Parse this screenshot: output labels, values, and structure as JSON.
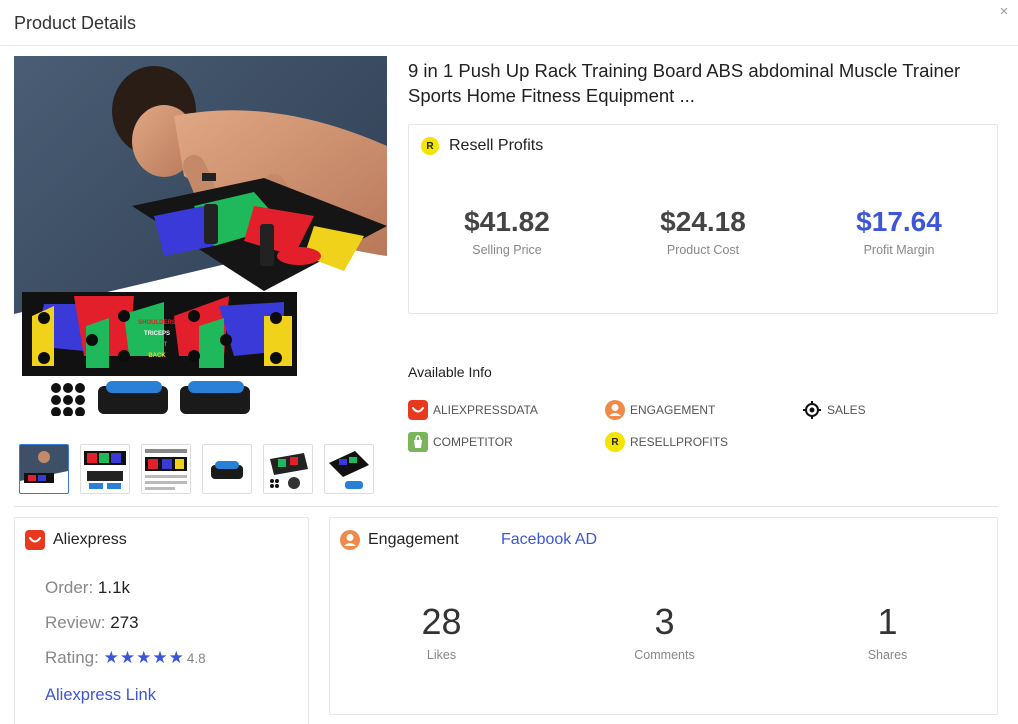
{
  "header": {
    "title": "Product Details",
    "close_symbol": "×"
  },
  "product": {
    "title": "9 in 1 Push Up Rack Training Board ABS abdominal Muscle Trainer Sports Home Fitness Equipment ...",
    "board_labels": [
      "SHOULDERS",
      "TRICEPS",
      "CHEST",
      "BACK"
    ],
    "thumbnail_count": 6,
    "active_thumbnail": 0
  },
  "resell": {
    "badge": "R",
    "title": "Resell Profits",
    "metrics": [
      {
        "value": "$41.82",
        "label": "Selling Price"
      },
      {
        "value": "$24.18",
        "label": "Product Cost"
      },
      {
        "value": "$17.64",
        "label": "Profit Margin"
      }
    ]
  },
  "available": {
    "title": "Available Info",
    "items": [
      {
        "label": "ALIEXPRESSDATA",
        "icon": "aliexpress-icon"
      },
      {
        "label": "ENGAGEMENT",
        "icon": "engagement-user-icon"
      },
      {
        "label": "SALES",
        "icon": "target-icon"
      },
      {
        "label": "COMPETITOR",
        "icon": "shopify-bag-icon"
      },
      {
        "label": "RESELLPROFITS",
        "icon": "resellprofits-badge-icon"
      }
    ]
  },
  "aliexpress": {
    "title": "Aliexpress",
    "order_label": "Order:",
    "order_value": "1.1k",
    "review_label": "Review:",
    "review_value": "273",
    "rating_label": "Rating:",
    "rating_stars": "★★★★★",
    "rating_value": "4.8",
    "link": "Aliexpress Link"
  },
  "engagement": {
    "title": "Engagement",
    "tab": "Facebook AD",
    "metrics": [
      {
        "value": "28",
        "label": "Likes"
      },
      {
        "value": "3",
        "label": "Comments"
      },
      {
        "value": "1",
        "label": "Shares"
      }
    ]
  },
  "colors": {
    "accent_blue": "#3d55d9",
    "aliexpress_red": "#e8391e",
    "engagement_orange": "#f08a4b",
    "shopify_green": "#7ab55c",
    "resell_yellow": "#f5e400"
  }
}
